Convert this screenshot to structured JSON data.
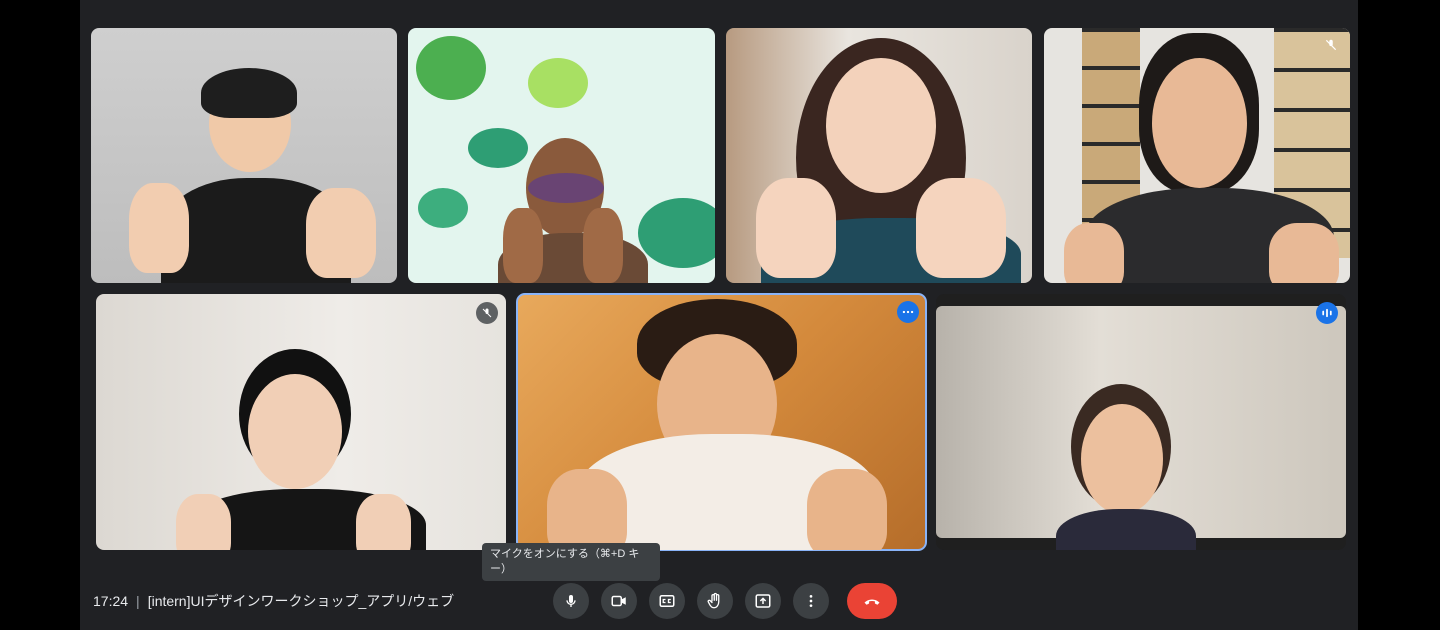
{
  "meeting": {
    "time": "17:24",
    "separator": "|",
    "title": "[intern]UIデザインワークショップ_アプリ/ウェブ"
  },
  "tooltip": {
    "text": "マイクをオンにする（⌘+D キー）"
  },
  "controls": [
    {
      "icon": "microphone-icon",
      "label": "microphone"
    },
    {
      "icon": "camera-icon",
      "label": "camera"
    },
    {
      "icon": "captions-icon",
      "label": "captions"
    },
    {
      "icon": "raise-hand-icon",
      "label": "raise hand"
    },
    {
      "icon": "present-screen-icon",
      "label": "present"
    },
    {
      "icon": "more-options-icon",
      "label": "more options"
    },
    {
      "icon": "end-call-icon",
      "label": "leave call"
    }
  ],
  "tiles": [
    {
      "id": "p1",
      "muted": false,
      "speaking": false,
      "active": false
    },
    {
      "id": "p2",
      "muted": false,
      "speaking": false,
      "active": false
    },
    {
      "id": "p3",
      "muted": false,
      "speaking": false,
      "active": false
    },
    {
      "id": "p4",
      "muted": true,
      "speaking": false,
      "active": false
    },
    {
      "id": "p5",
      "muted": true,
      "speaking": false,
      "active": false
    },
    {
      "id": "p6",
      "muted": false,
      "speaking": false,
      "active": true
    },
    {
      "id": "p7",
      "muted": false,
      "speaking": true,
      "active": false
    }
  ],
  "colors": {
    "background": "#202124",
    "control_bg": "#3c4043",
    "end_call": "#ea4335",
    "accent": "#1a73e8",
    "active_border": "#8ab4f8"
  }
}
